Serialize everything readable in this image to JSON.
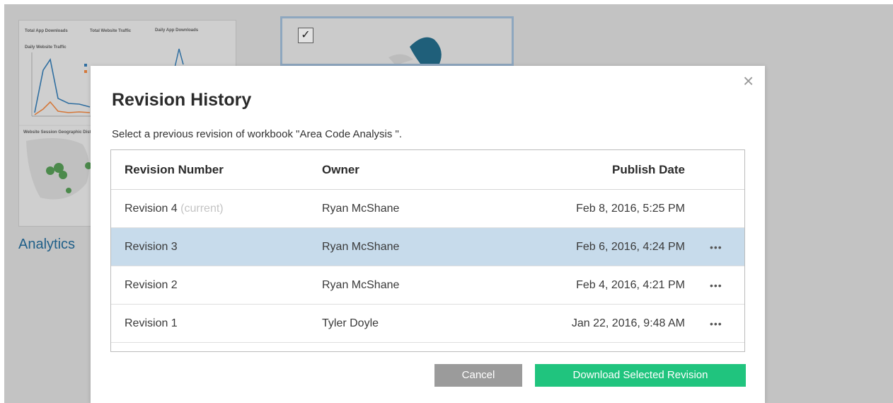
{
  "background": {
    "workbook_label": "Analytics",
    "thumbnail_labels": [
      "Total App Downloads",
      "Total Website Traffic",
      "Daily App Downloads",
      "Daily Website Traffic",
      "Website Session Geographic Dist"
    ],
    "checkbox_mark": "✓"
  },
  "dialog": {
    "title": "Revision History",
    "subtitle": "Select a previous revision of workbook \"Area Code Analysis \".",
    "close_icon": "×",
    "columns": [
      "Revision Number",
      "Owner",
      "Publish Date"
    ],
    "rows": [
      {
        "revision": "Revision 4",
        "current_tag": "(current)",
        "owner": "Ryan McShane",
        "date": "Feb 8, 2016, 5:25 PM",
        "more": ""
      },
      {
        "revision": "Revision 3",
        "current_tag": "",
        "owner": "Ryan McShane",
        "date": "Feb 6, 2016, 4:24 PM",
        "more": "•••",
        "selected": true
      },
      {
        "revision": "Revision 2",
        "current_tag": "",
        "owner": "Ryan McShane",
        "date": "Feb 4, 2016, 4:21 PM",
        "more": "•••"
      },
      {
        "revision": "Revision 1",
        "current_tag": "",
        "owner": "Tyler Doyle",
        "date": "Jan 22, 2016, 9:48 AM",
        "more": "•••"
      }
    ],
    "cancel_label": "Cancel",
    "download_label": "Download Selected Revision"
  },
  "colors": {
    "selected_row": "#c7dbeb",
    "download_button": "#20c47e",
    "cancel_button": "#9b9b9b",
    "link": "#1f5f89"
  }
}
